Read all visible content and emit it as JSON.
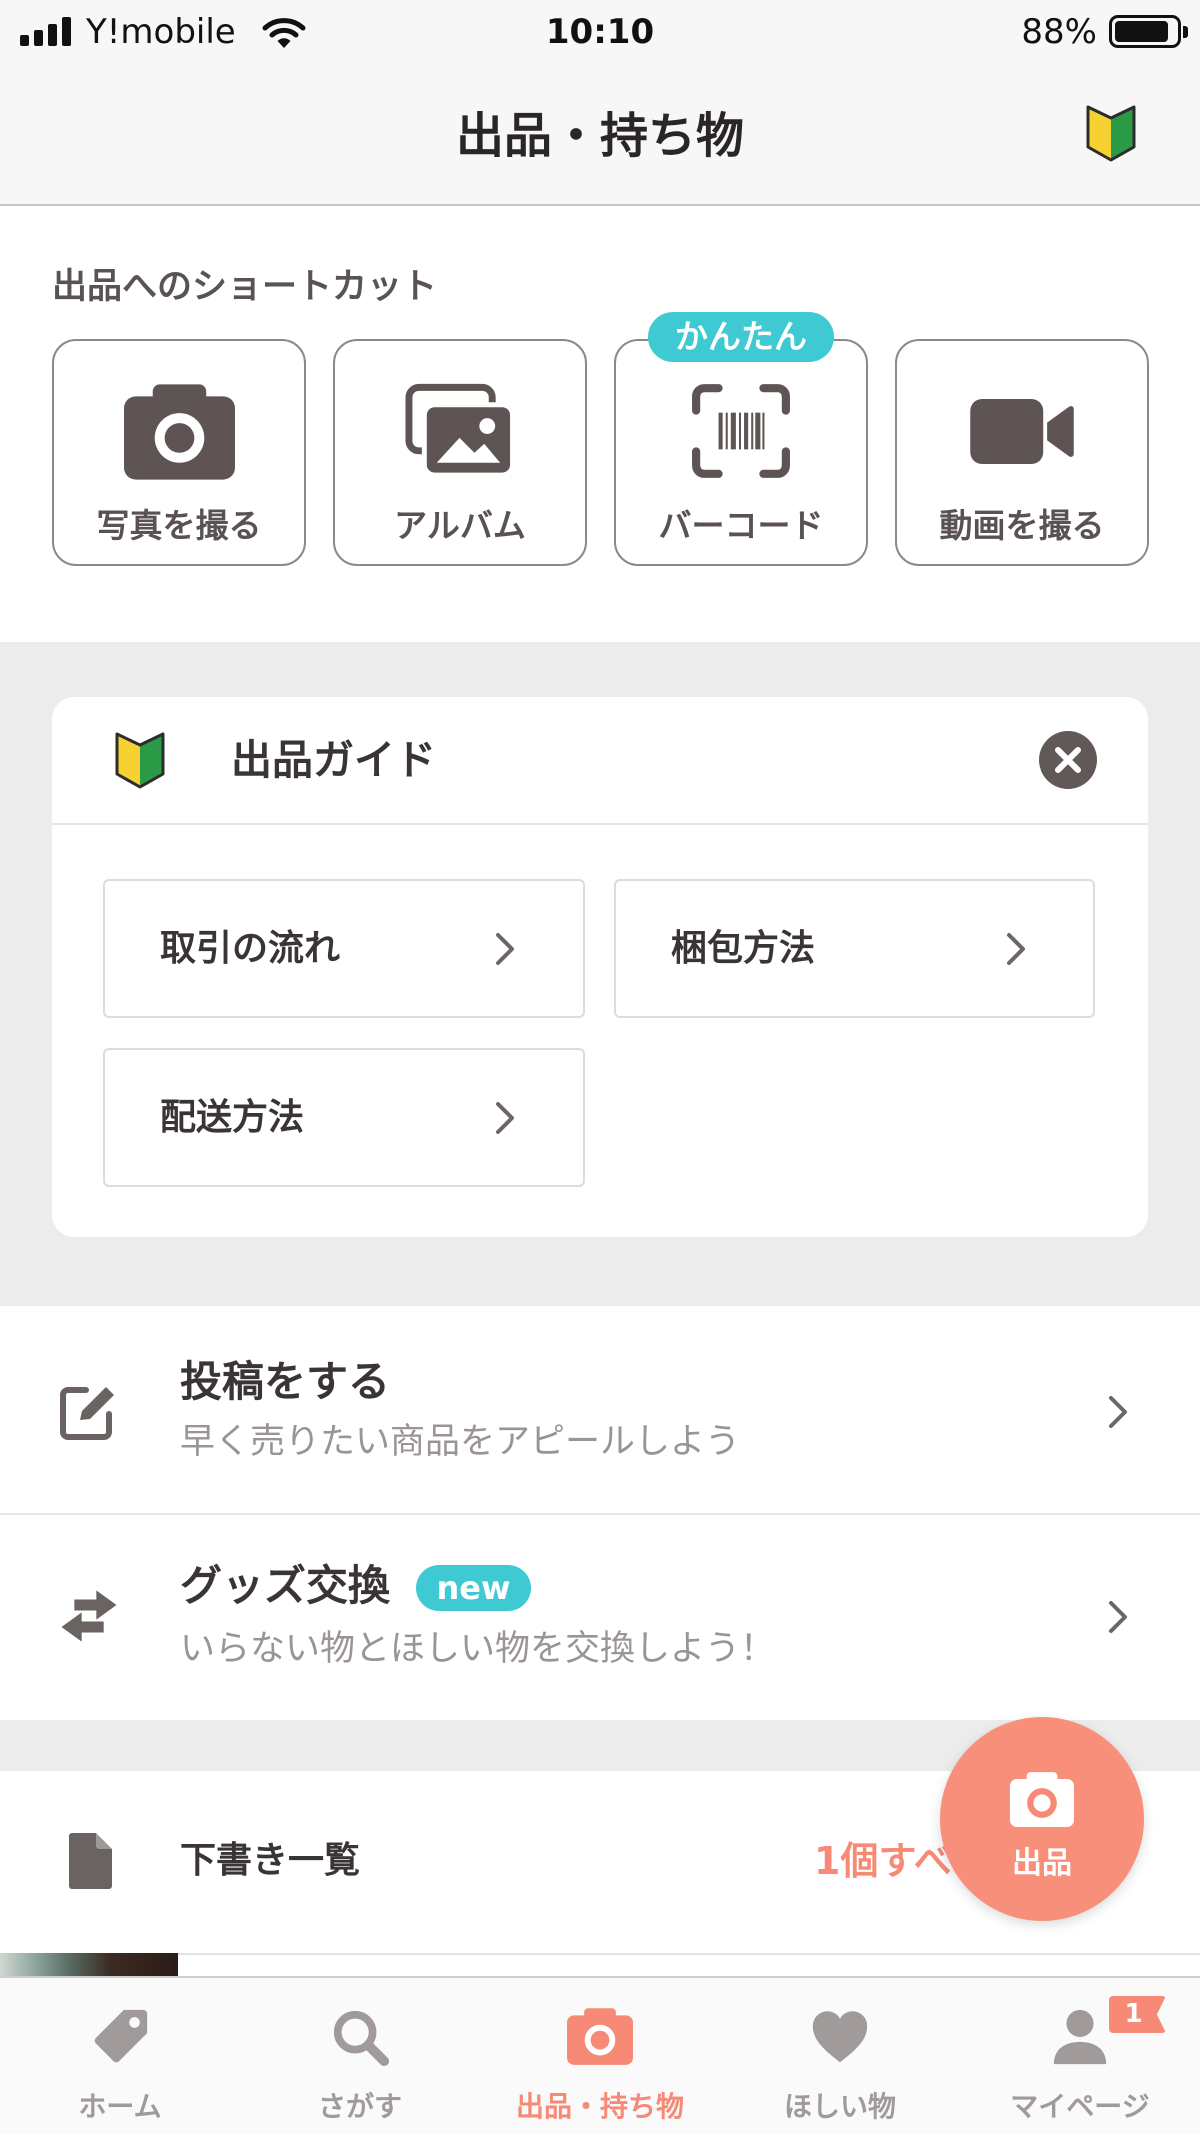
{
  "status_bar": {
    "carrier": "Y!mobile",
    "time": "10:10",
    "battery": "88%",
    "battery_level": 0.88
  },
  "header": {
    "title": "出品・持ち物",
    "icon": "beginner-mark-icon"
  },
  "shortcuts": {
    "title": "出品へのショートカット",
    "items": [
      {
        "label": "写真を撮る",
        "icon": "camera-icon"
      },
      {
        "label": "アルバム",
        "icon": "album-icon"
      },
      {
        "label": "バーコード",
        "icon": "barcode-icon",
        "badge": "かんたん"
      },
      {
        "label": "動画を撮る",
        "icon": "video-camera-icon"
      }
    ]
  },
  "guide": {
    "title": "出品ガイド",
    "icon": "beginner-mark-icon",
    "close_icon": "close-icon",
    "links": [
      {
        "label": "取引の流れ"
      },
      {
        "label": "梱包方法"
      },
      {
        "label": "配送方法"
      }
    ]
  },
  "menu": {
    "items": [
      {
        "title": "投稿をする",
        "subtitle": "早く売りたい商品をアピールしよう",
        "icon": "edit-icon"
      },
      {
        "title": "グッズ交換",
        "badge": "new",
        "subtitle": "いらない物とほしい物を交換しよう！",
        "icon": "exchange-icon"
      }
    ]
  },
  "drafts": {
    "title": "下書き一覧",
    "link": "1個すべ",
    "icon": "document-icon"
  },
  "fab": {
    "label": "出品",
    "icon": "camera-icon"
  },
  "tabbar": {
    "items": [
      {
        "label": "ホーム",
        "icon": "tag-icon"
      },
      {
        "label": "さがす",
        "icon": "search-icon"
      },
      {
        "label": "出品・持ち物",
        "icon": "camera-icon",
        "active": true
      },
      {
        "label": "ほしい物",
        "icon": "heart-icon"
      },
      {
        "label": "マイページ",
        "icon": "person-icon",
        "badge": "1"
      }
    ]
  },
  "colors": {
    "accent": "#f68a76",
    "teal": "#3fcad3",
    "text": "#3a3434",
    "icon": "#5e5454",
    "tab_inactive": "#a09a9a"
  }
}
